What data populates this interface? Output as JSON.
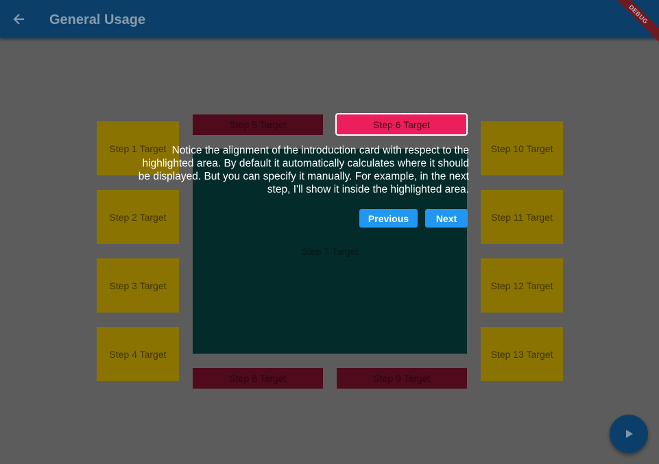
{
  "appbar": {
    "title": "General Usage",
    "back_icon": "arrow-left-icon",
    "debug_banner": "DEBUG"
  },
  "targets": {
    "step1": "Step 1 Target",
    "step2": "Step 2 Target",
    "step3": "Step 3 Target",
    "step4": "Step 4 Target",
    "step5": "Step 5 Target",
    "step6": "Step 6 Target",
    "step7": "Step 7 Target",
    "step8": "Step 8 Target",
    "step9": "Step 9 Target",
    "step10": "Step 10 Target",
    "step11": "Step 11 Target",
    "step12": "Step 12 Target",
    "step13": "Step 13 Target"
  },
  "intro_card": {
    "text": "Notice the alignment of the introduction card with respect to the highlighted area. By default it automatically calculates where it should be displayed. But you can specify it manually. For example, in the next step, I'll show it inside the highlighted area.",
    "previous_label": "Previous",
    "next_label": "Next"
  },
  "fab": {
    "icon": "play-icon"
  },
  "colors": {
    "overlay": "#5c5c5c",
    "appbar": "#0b3f6a",
    "highlight": "#ec1e5c",
    "button": "#2196f3"
  }
}
